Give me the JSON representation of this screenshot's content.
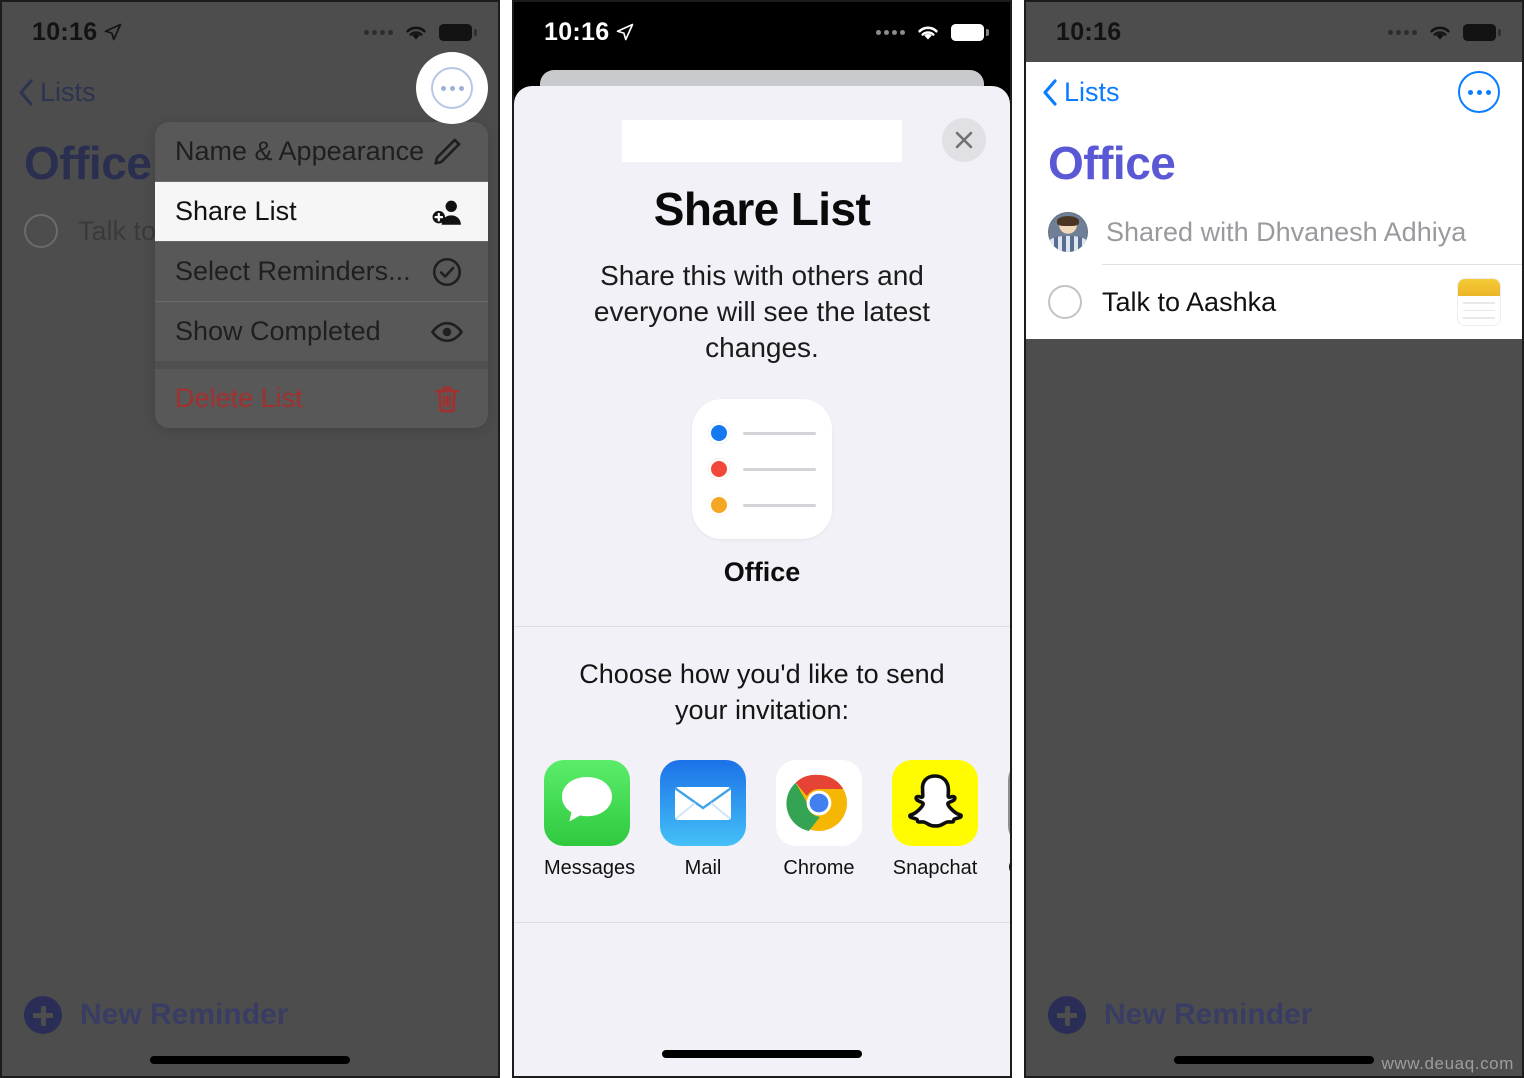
{
  "panel1": {
    "status": {
      "time": "10:16",
      "location_icon": "location-arrow-icon",
      "wifi_icon": "wifi-icon",
      "battery_icon": "battery-icon"
    },
    "nav": {
      "back_label": "Lists",
      "back_icon": "chevron-left-icon",
      "more_icon": "ellipsis-circle-icon"
    },
    "title": "Office",
    "reminders": [
      {
        "text": "Talk to A",
        "checkbox": "circle-checkbox-icon"
      }
    ],
    "context_menu": [
      {
        "label": "Name & Appearance",
        "icon": "pencil-icon",
        "state": "normal"
      },
      {
        "label": "Share List",
        "icon": "person-add-icon",
        "state": "highlighted"
      },
      {
        "label": "Select Reminders...",
        "icon": "check-circle-icon",
        "state": "normal"
      },
      {
        "label": "Show Completed",
        "icon": "eye-icon",
        "state": "normal"
      },
      {
        "label": "Delete List",
        "icon": "trash-icon",
        "state": "destructive"
      }
    ],
    "new_reminder": {
      "label": "New Reminder",
      "icon": "plus-circle-icon"
    }
  },
  "panel2": {
    "status": {
      "time": "10:16",
      "location_icon": "location-arrow-icon",
      "wifi_icon": "wifi-icon",
      "battery_icon": "battery-icon"
    },
    "close_icon": "close-x-icon",
    "title": "Share List",
    "subtitle": "Share this with others and everyone will see the latest changes.",
    "list_icon": {
      "name": "reminders-list-icon",
      "label": "Office",
      "bullet_colors": [
        "#1478f0",
        "#f1483a",
        "#f5a623"
      ]
    },
    "send_prompt": "Choose how you'd like to send your invitation:",
    "apps": [
      {
        "label": "Messages",
        "icon": "messages-app-icon",
        "color": "#4cd964"
      },
      {
        "label": "Mail",
        "icon": "mail-app-icon",
        "color": "#1e90ff"
      },
      {
        "label": "Chrome",
        "icon": "chrome-app-icon",
        "color": "#ffffff"
      },
      {
        "label": "Snapchat",
        "icon": "snapchat-app-icon",
        "color": "#fffc00"
      },
      {
        "label": "Co",
        "icon": "copy-app-icon",
        "color": "#8e8e93"
      }
    ]
  },
  "panel3": {
    "status": {
      "time": "10:16",
      "wifi_icon": "wifi-icon",
      "battery_icon": "battery-icon"
    },
    "nav": {
      "back_label": "Lists",
      "back_icon": "chevron-left-icon",
      "more_icon": "ellipsis-circle-icon"
    },
    "title": "Office",
    "shared_row": {
      "text": "Shared with Dhvanesh Adhiya",
      "avatar": "contact-avatar"
    },
    "reminders": [
      {
        "text": "Talk to Aashka",
        "checkbox": "circle-checkbox-icon",
        "trailing_icon": "notes-app-icon"
      }
    ],
    "new_reminder": {
      "label": "New Reminder",
      "icon": "plus-circle-icon"
    }
  },
  "watermark": "www.deuaq.com",
  "colors": {
    "ios_blue": "#0a7cff",
    "indigo": "#5b58d6",
    "destructive_red": "#a3302f",
    "sheet_bg": "#f1f1f7"
  }
}
